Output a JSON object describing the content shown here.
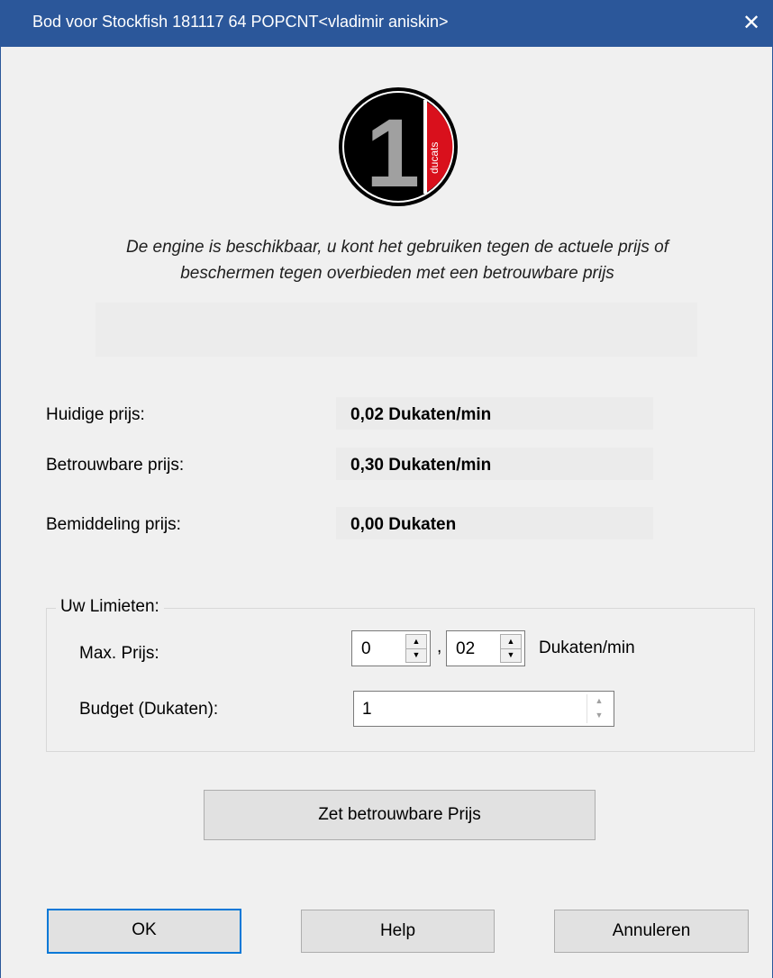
{
  "window": {
    "title": "Bod voor Stockfish 181117 64 POPCNT<vladimir aniskin>",
    "close_label": "✕"
  },
  "logo": {
    "number": "1",
    "text": "ducats",
    "accent_color": "#d9101c"
  },
  "description": "De engine is beschikbaar, u kont het gebruiken tegen de actuele prijs of beschermen tegen overbieden met een betrouwbare prijs",
  "prices": {
    "current": {
      "label": "Huidige prijs:",
      "value": "0,02 Dukaten/min"
    },
    "reliable": {
      "label": "Betrouwbare prijs:",
      "value": "0,30 Dukaten/min"
    },
    "mediation": {
      "label": "Bemiddeling prijs:",
      "value": "0,00 Dukaten"
    }
  },
  "limits": {
    "title": "Uw Limieten:",
    "max_price": {
      "label": "Max. Prijs:",
      "whole": "0",
      "separator": ",",
      "fraction": "02",
      "unit": "Dukaten/min"
    },
    "budget": {
      "label": "Budget (Dukaten):",
      "value": "1"
    }
  },
  "buttons": {
    "set_reliable": "Zet betrouwbare Prijs",
    "ok": "OK",
    "help": "Help",
    "cancel": "Annuleren"
  }
}
